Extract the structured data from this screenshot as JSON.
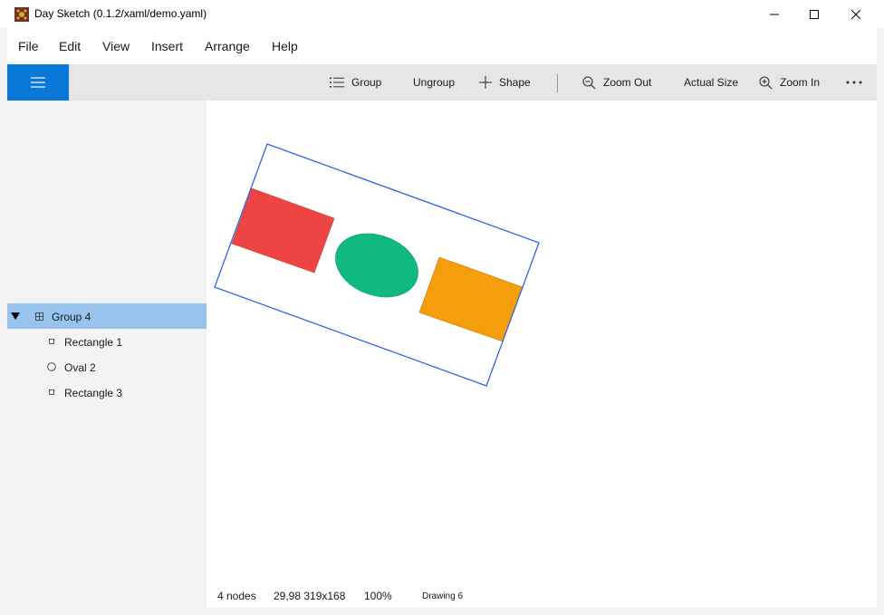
{
  "window": {
    "title": "Day Sketch (0.1.2/xaml/demo.yaml)",
    "controls": [
      "minimize-icon",
      "maximize-icon",
      "close-icon"
    ]
  },
  "menu": {
    "items": [
      "File",
      "Edit",
      "View",
      "Insert",
      "Arrange",
      "Help"
    ]
  },
  "toolbar": {
    "group_label": "Group",
    "ungroup_label": "Ungroup",
    "shape_label": "Shape",
    "zoom_out_label": "Zoom Out",
    "actual_size_label": "Actual Size",
    "zoom_in_label": "Zoom In",
    "accent_color": "#0a78d7"
  },
  "tree": {
    "nodes": [
      {
        "label": "Group 4",
        "icon": "group-icon",
        "expanded": true,
        "selected": true
      },
      {
        "label": "Rectangle 1",
        "icon": "rectangle-icon"
      },
      {
        "label": "Oval 2",
        "icon": "oval-icon"
      },
      {
        "label": "Rectangle 3",
        "icon": "rectangle-icon"
      }
    ],
    "selected_color": "#97c3ec"
  },
  "drawing": {
    "shapes": [
      {
        "name": "Rectangle 1",
        "type": "rectangle",
        "fill": "#ef4444"
      },
      {
        "name": "Oval 2",
        "type": "oval",
        "fill": "#10b981"
      },
      {
        "name": "Rectangle 3",
        "type": "rectangle",
        "fill": "#f59e0b"
      }
    ],
    "selection_color": "#3366dd"
  },
  "status": {
    "nodes": "4 nodes",
    "bounds": "29,98 319x168",
    "zoom": "100%",
    "drawing": "Drawing 6"
  }
}
